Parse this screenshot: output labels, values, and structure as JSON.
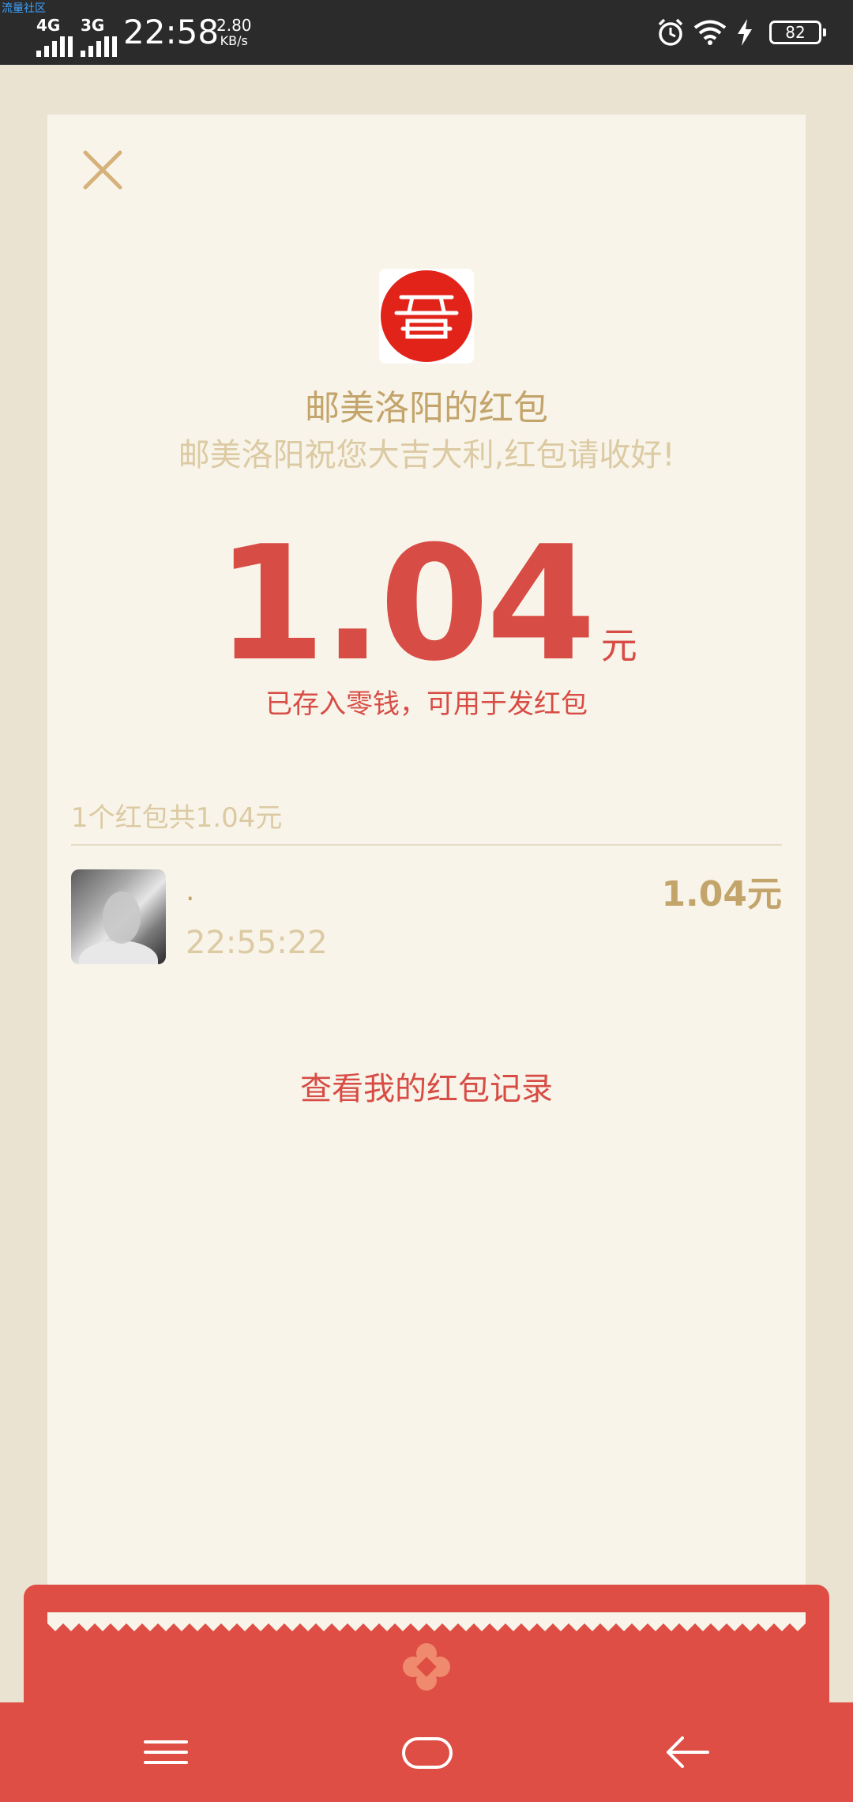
{
  "status_bar": {
    "watermark": "流量社区",
    "network_1": "4G",
    "network_2": "3G",
    "time": "22:58",
    "speed_value": "2.80",
    "speed_unit": "KB/s",
    "battery": "82",
    "icons": [
      "alarm-icon",
      "wifi-icon",
      "charging-icon",
      "battery-icon"
    ]
  },
  "red_packet": {
    "sender_title": "邮美洛阳的红包",
    "blessing": "邮美洛阳祝您大吉大利,红包请收好!",
    "amount": "1.04",
    "amount_unit": "元",
    "stored_note": "已存入零钱，可用于发红包",
    "summary": "1个红包共1.04元",
    "receivers": [
      {
        "name": ".",
        "time": "22:55:22",
        "amount": "1.04元"
      }
    ],
    "record_link": "查看我的红包记录"
  },
  "colors": {
    "accent_red": "#d74c45",
    "gold": "#c3a46b",
    "card_bg": "#f8f4e9",
    "page_bg": "#ebe3d2"
  },
  "nav_icons": [
    "menu-icon",
    "home-icon",
    "back-icon"
  ]
}
